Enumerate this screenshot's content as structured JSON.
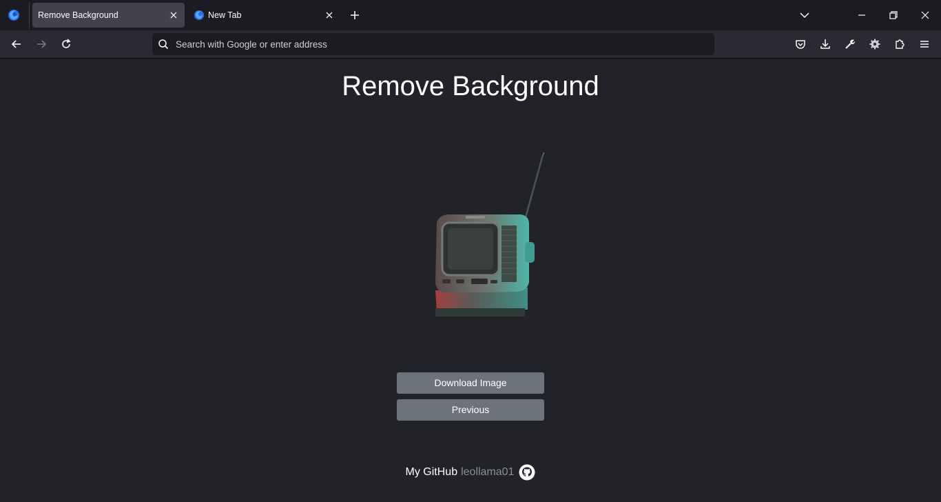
{
  "browser": {
    "tabs": [
      {
        "label": "Remove Background",
        "active": true
      },
      {
        "label": "New Tab",
        "active": false
      }
    ],
    "address_placeholder": "Search with Google or enter address",
    "icons": [
      "firefox-icon",
      "close-icon",
      "new-tab-icon",
      "list-all-tabs-icon",
      "minimize-icon",
      "restore-icon",
      "window-close-icon",
      "back-icon",
      "forward-icon",
      "reload-icon",
      "search-icon",
      "pocket-icon",
      "downloads-icon",
      "wrench-icon",
      "extension-gear-icon",
      "extensions-icon",
      "menu-icon"
    ]
  },
  "page": {
    "title": "Remove Background",
    "download_label": "Download Image",
    "previous_label": "Previous",
    "footer": {
      "prefix": "My GitHub",
      "username": "leollama01",
      "icon": "github-icon"
    }
  },
  "colors": {
    "page_bg": "#212329",
    "button_bg": "#6c737d",
    "tab_active_bg": "#42414d",
    "toolbar_bg": "#2b2a33"
  }
}
